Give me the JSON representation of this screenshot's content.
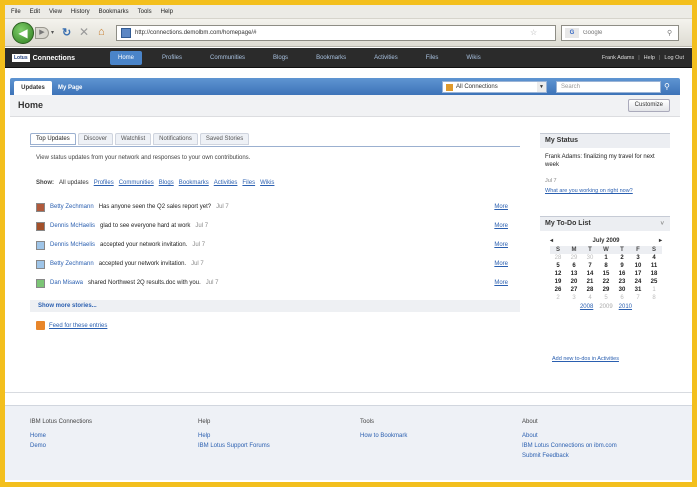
{
  "browser": {
    "menu": [
      "File",
      "Edit",
      "View",
      "History",
      "Bookmarks",
      "Tools",
      "Help"
    ],
    "url": "http://connections.demolbm.com/homepage/#",
    "search_placeholder": "Google",
    "search_engine": "G"
  },
  "lotus": {
    "logo_badge": "Lotus",
    "logo_text": "Connections",
    "nav": [
      "Home",
      "Profiles",
      "Communities",
      "Blogs",
      "Bookmarks",
      "Activities",
      "Files",
      "Wikis"
    ],
    "user": "Frank Adams",
    "help": "Help",
    "logout": "Log Out"
  },
  "tabs": {
    "updates": "Updates",
    "my_page": "My Page",
    "scope": "All Connections",
    "search_placeholder": "Search"
  },
  "home": {
    "title": "Home",
    "customize": "Customize"
  },
  "updates": {
    "subtabs": [
      "Top Updates",
      "Discover",
      "Watchlist",
      "Notifications",
      "Saved Stories"
    ],
    "description": "View status updates from your network and responses to your own contributions.",
    "show_label": "Show:",
    "filters": [
      "All updates",
      "Profiles",
      "Communities",
      "Blogs",
      "Bookmarks",
      "Activities",
      "Files",
      "Wikis"
    ],
    "stories": [
      {
        "who": "Betty Zechmann",
        "what": "Has anyone seen the Q2 sales report yet?",
        "when": "Jul 7",
        "more": "More"
      },
      {
        "who": "Dennis McHaelis",
        "what": "glad to see everyone hard at work",
        "when": "Jul 7",
        "more": "More"
      },
      {
        "who": "Dennis McHaelis",
        "what": "accepted your network invitation.",
        "when": "Jul 7",
        "more": "More"
      },
      {
        "who": "Betty Zechmann",
        "what": "accepted your network invitation.",
        "when": "Jul 7",
        "more": "More"
      },
      {
        "who": "Dan Misawa",
        "what": "shared Northwest 2Q results.doc with you.",
        "when": "Jul 7",
        "more": "More"
      }
    ],
    "show_more": "Show more stories...",
    "feed": "Feed for these entries"
  },
  "status": {
    "heading": "My Status",
    "text": "Frank Adams: finalizing my travel for next week",
    "when": "Jul 7",
    "question": "What are you working on right now?"
  },
  "todo": {
    "heading": "My To-Do List",
    "collapse": "˅",
    "prev": "◂",
    "next": "▸",
    "month": "July 2009",
    "dow": [
      "S",
      "M",
      "T",
      "W",
      "T",
      "F",
      "S"
    ],
    "weeks": [
      [
        {
          "v": "28",
          "o": true
        },
        {
          "v": "29",
          "o": true
        },
        {
          "v": "30",
          "o": true
        },
        {
          "v": "1"
        },
        {
          "v": "2"
        },
        {
          "v": "3"
        },
        {
          "v": "4"
        }
      ],
      [
        {
          "v": "5"
        },
        {
          "v": "6"
        },
        {
          "v": "7"
        },
        {
          "v": "8"
        },
        {
          "v": "9"
        },
        {
          "v": "10"
        },
        {
          "v": "11"
        }
      ],
      [
        {
          "v": "12"
        },
        {
          "v": "13"
        },
        {
          "v": "14"
        },
        {
          "v": "15"
        },
        {
          "v": "16"
        },
        {
          "v": "17"
        },
        {
          "v": "18"
        }
      ],
      [
        {
          "v": "19"
        },
        {
          "v": "20"
        },
        {
          "v": "21"
        },
        {
          "v": "22"
        },
        {
          "v": "23"
        },
        {
          "v": "24"
        },
        {
          "v": "25"
        }
      ],
      [
        {
          "v": "26"
        },
        {
          "v": "27"
        },
        {
          "v": "28"
        },
        {
          "v": "29"
        },
        {
          "v": "30"
        },
        {
          "v": "31"
        },
        {
          "v": "1",
          "o": true
        }
      ],
      [
        {
          "v": "2",
          "o": true
        },
        {
          "v": "3",
          "o": true
        },
        {
          "v": "4",
          "o": true
        },
        {
          "v": "5",
          "o": true
        },
        {
          "v": "6",
          "o": true
        },
        {
          "v": "7",
          "o": true
        },
        {
          "v": "8",
          "o": true
        }
      ]
    ],
    "years": [
      "2008",
      "2009",
      "2010"
    ],
    "add": "Add new to-dos in Activities"
  },
  "footer": {
    "columns": [
      {
        "heading": "IBM Lotus Connections",
        "links": [
          "Home",
          "Demo"
        ]
      },
      {
        "heading": "Help",
        "links": [
          "Help",
          "IBM Lotus Support Forums"
        ]
      },
      {
        "heading": "Tools",
        "links": [
          "How to Bookmark"
        ]
      },
      {
        "heading": "About",
        "links": [
          "About",
          "IBM Lotus Connections on ibm.com",
          "Submit Feedback"
        ]
      }
    ]
  },
  "colors": {
    "frame": "#f3bf1d",
    "tab_blue": "#4a84c9",
    "link": "#2a5fb0"
  }
}
